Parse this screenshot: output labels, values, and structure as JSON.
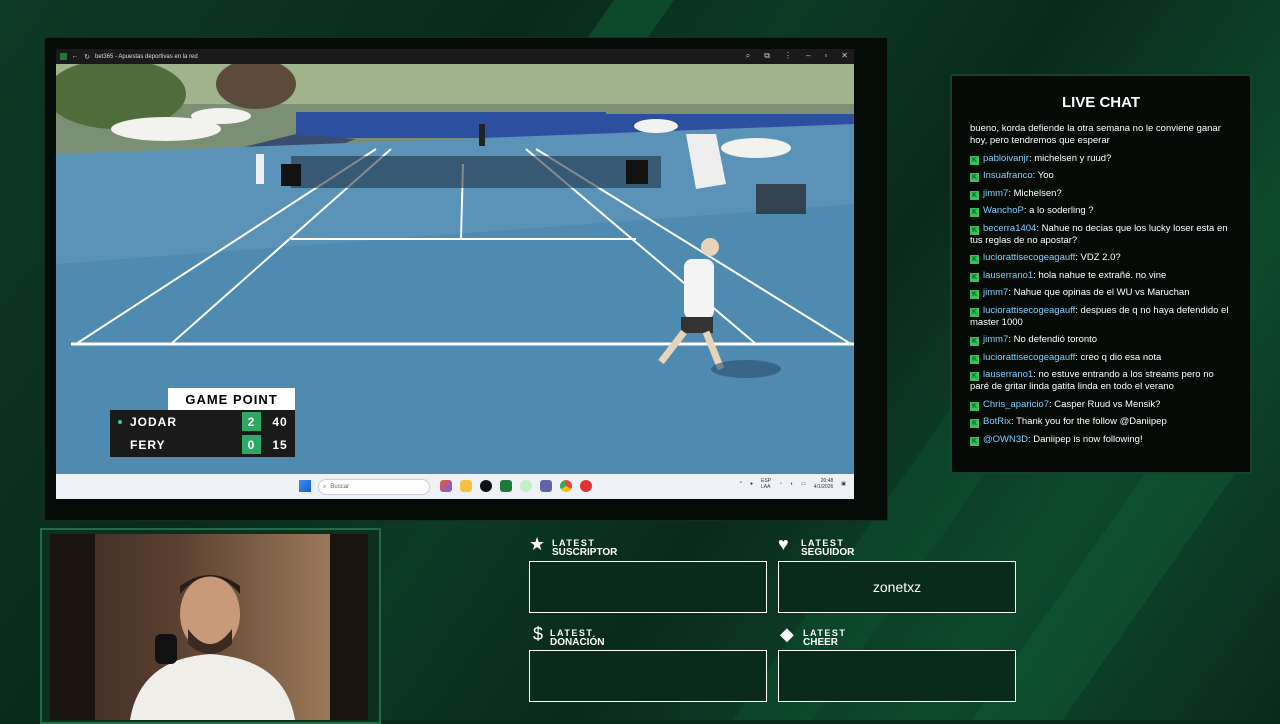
{
  "browser": {
    "tab_title": "bet365 - Apuestas deportivas en la red"
  },
  "taskbar": {
    "search_placeholder": "Buscar",
    "lang": "ESP",
    "lang2": "LAA",
    "time": "20:48",
    "date": "4/1/2026"
  },
  "scoreboard": {
    "banner": "GAME POINT",
    "players": [
      {
        "name": "JODAR",
        "sets": "2",
        "points": "40",
        "serving": true
      },
      {
        "name": "FERY",
        "sets": "0",
        "points": "15",
        "serving": false
      }
    ]
  },
  "chat": {
    "title": "LIVE CHAT",
    "messages": [
      {
        "user": "",
        "text": "bueno, korda defiende la otra semana no le conviene ganar hoy, pero tendremos que esperar",
        "badge": false
      },
      {
        "user": "pabloivanjr",
        "text": "michelsen y ruud?",
        "badge": true
      },
      {
        "user": "Insuafranco",
        "text": "Yoo",
        "badge": true
      },
      {
        "user": "jimm7",
        "text": "Michelsen?",
        "badge": true
      },
      {
        "user": "WanchoP",
        "text": "a lo soderling ?",
        "badge": true
      },
      {
        "user": "becerra1404",
        "text": "Nahue no decias que los lucky loser esta en tus reglas de no apostar?",
        "badge": true
      },
      {
        "user": "luciorattisecogeagauff",
        "text": "VDZ 2.0?",
        "badge": true
      },
      {
        "user": "lauserrano1",
        "text": "hola nahue te extrañé. no vine",
        "badge": true
      },
      {
        "user": "jimm7",
        "text": "Nahue que opinas de el WU vs Maruchan",
        "badge": true
      },
      {
        "user": "luciorattisecogeagauff",
        "text": "despues de q no haya defendido el master 1000",
        "badge": true
      },
      {
        "user": "jimm7",
        "text": "No defendió toronto",
        "badge": true
      },
      {
        "user": "luciorattisecogeagauff",
        "text": "creo q dio esa nota",
        "badge": true
      },
      {
        "user": "lauserrano1",
        "text": "no estuve entrando a los streams pero no paré de gritar linda gatita linda en todo el verano",
        "badge": true
      },
      {
        "user": "Chris_aparicio7",
        "text": "Casper Ruud vs Mensik?",
        "badge": true
      },
      {
        "user": "BotRix",
        "text": "Thank you for the follow @Daniipep",
        "badge": true
      },
      {
        "user": "@OWN3D",
        "text": "Daniipep is now following!",
        "badge": true
      }
    ]
  },
  "alerts": {
    "suscriptor": {
      "small": "LATEST",
      "big": "SUSCRIPTOR",
      "value": "",
      "icon": "star-icon"
    },
    "seguidor": {
      "small": "LATEST",
      "big": "SEGUIDOR",
      "value": "zonetxz",
      "icon": "heart-icon"
    },
    "donacion": {
      "small": "LATEST",
      "big": "DONACIÓN",
      "value": "",
      "icon": "dollar-icon"
    },
    "cheer": {
      "small": "LATEST",
      "big": "CHEER",
      "value": "",
      "icon": "diamond-icon"
    }
  },
  "colors": {
    "accent": "#2fa866",
    "chat_user": "#7fd0ff",
    "court": "#4f8bb0"
  }
}
